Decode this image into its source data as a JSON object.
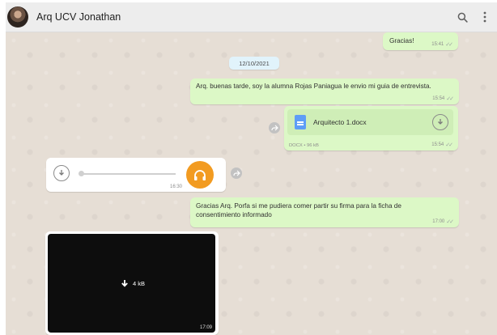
{
  "header": {
    "contact_name": "Arq UCV Jonathan",
    "search_icon": "search-icon",
    "menu_icon": "kebab-menu-icon"
  },
  "colors": {
    "header_bg": "#ededed",
    "chat_bg": "#e6ded5",
    "outgoing_bubble": "#dcf8c6",
    "incoming_bubble": "#ffffff",
    "date_chip": "#e1f3fb",
    "audio_accent": "#f29b21",
    "doc_icon": "#5e9df6"
  },
  "messages": {
    "gracias": {
      "text": "Gracias!",
      "time": "15:41"
    },
    "date_separator": "12/10/2021",
    "intro": {
      "text": "Arq. buenas tarde, soy la alumna Rojas Paniagua le envio mi guia de entrevista.",
      "time": "15:54"
    },
    "document": {
      "file_name": "Arquitecto 1.docx",
      "meta": "DOCX • 96 kB",
      "time": "15:54"
    },
    "audio": {
      "time": "16:30"
    },
    "consent": {
      "text": "Gracias Arq. Porfa si me pudiera comer partir su firma para  la ficha de consentimiento informado",
      "time": "17:00"
    },
    "image": {
      "size": "4 kB",
      "time": "17:09"
    }
  }
}
